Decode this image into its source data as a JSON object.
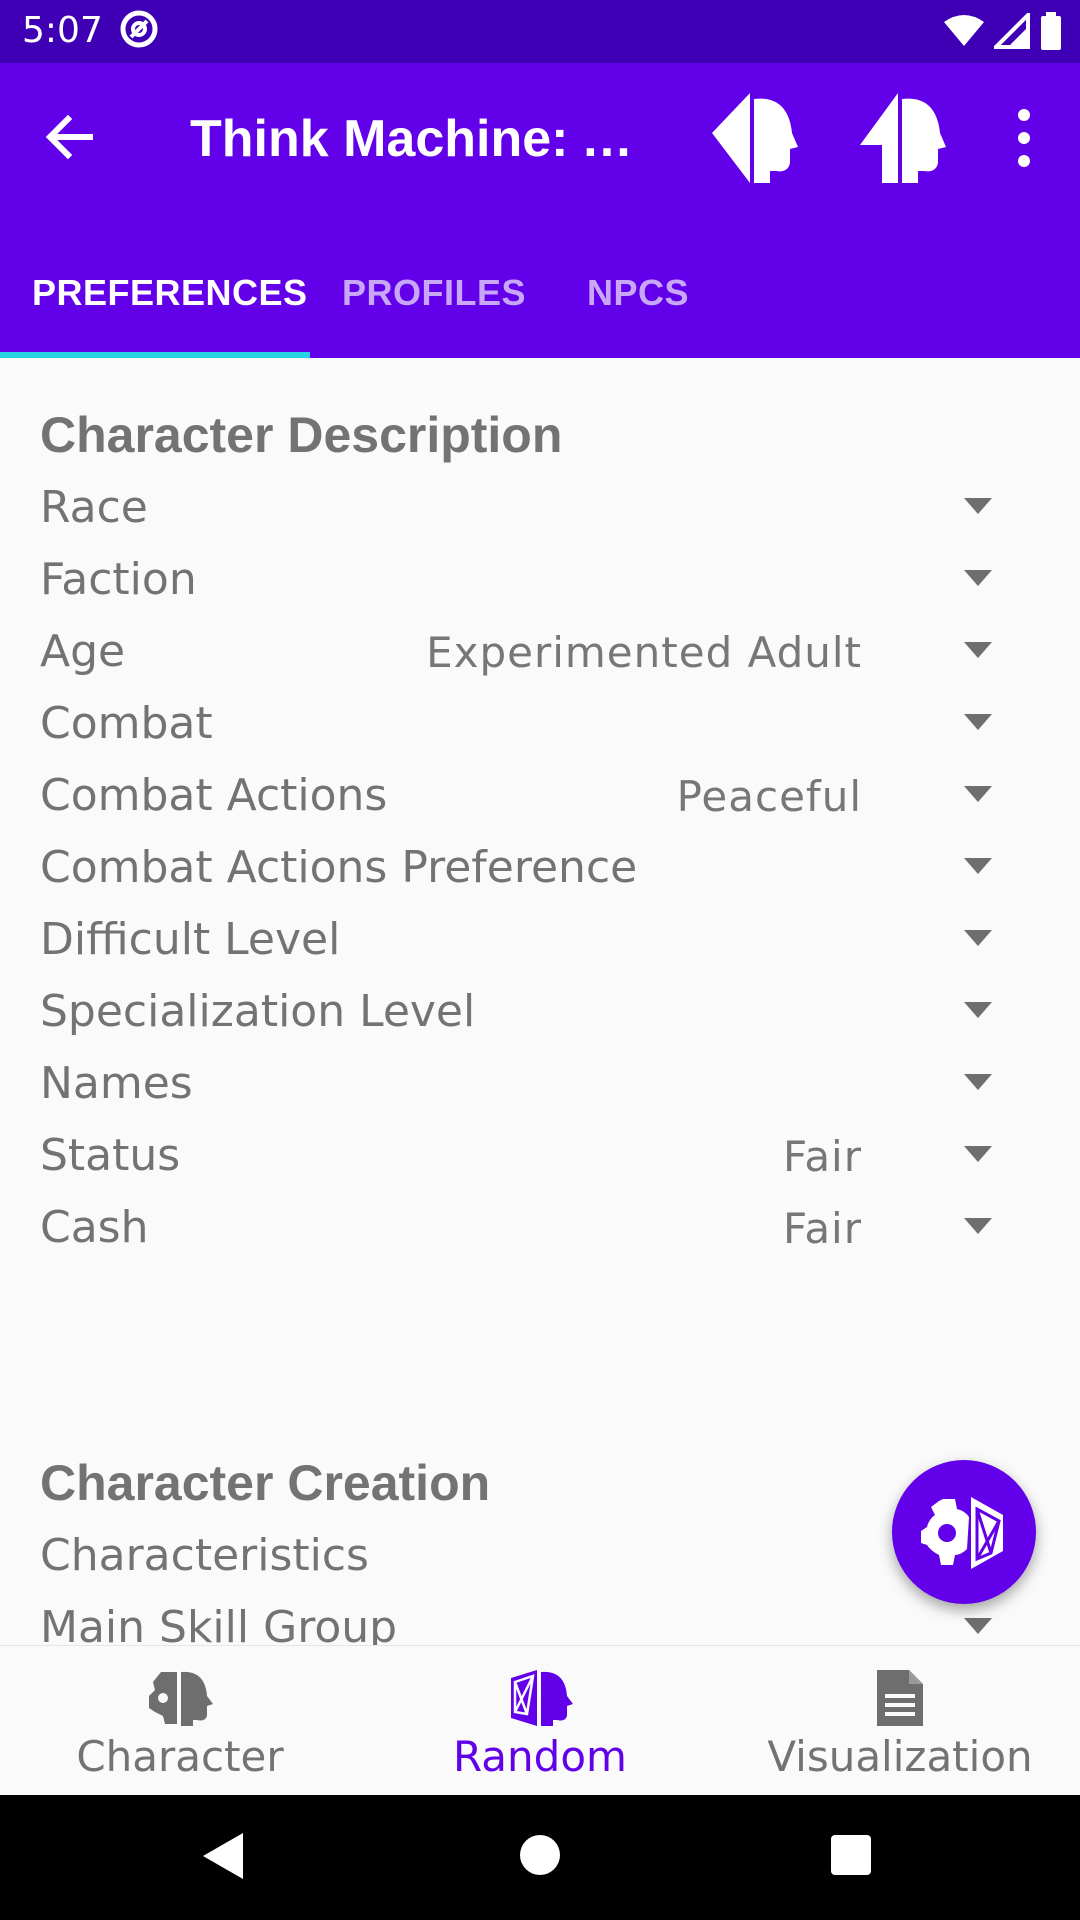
{
  "status_bar": {
    "time": "5:07"
  },
  "app_bar": {
    "title": "Think Machine: A…"
  },
  "tabs": [
    {
      "label": "PREFERENCES",
      "active": true
    },
    {
      "label": "PROFILES",
      "active": false
    },
    {
      "label": "NPCS",
      "active": false
    }
  ],
  "character_description": {
    "title": "Character Description",
    "rows": [
      {
        "label": "Race",
        "value": ""
      },
      {
        "label": "Faction",
        "value": ""
      },
      {
        "label": "Age",
        "value": "Experimented Adult"
      },
      {
        "label": "Combat",
        "value": ""
      },
      {
        "label": "Combat Actions",
        "value": "Peaceful"
      },
      {
        "label": "Combat Actions Preference",
        "value": ""
      },
      {
        "label": "Difficult Level",
        "value": ""
      },
      {
        "label": "Specialization Level",
        "value": ""
      },
      {
        "label": "Names",
        "value": ""
      },
      {
        "label": "Status",
        "value": "Fair"
      },
      {
        "label": "Cash",
        "value": "Fair"
      }
    ]
  },
  "character_creation": {
    "title": "Character Creation",
    "rows": [
      {
        "label": "Characteristics",
        "value": ""
      },
      {
        "label": "Main Skill Group",
        "value": ""
      }
    ]
  },
  "bottom_nav": [
    {
      "label": "Character",
      "icon": "character-head-icon",
      "active": false
    },
    {
      "label": "Random",
      "icon": "random-head-icon",
      "active": true
    },
    {
      "label": "Visualization",
      "icon": "document-icon",
      "active": false
    }
  ],
  "colors": {
    "primary": "#6200ea",
    "status_bar": "#3f00b5",
    "tab_indicator": "#26d4e6",
    "text_gray": "#737373"
  }
}
